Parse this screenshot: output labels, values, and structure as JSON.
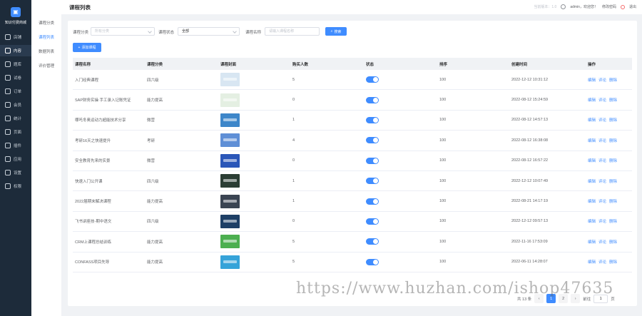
{
  "app": {
    "brand": "知识付费商城"
  },
  "rail": [
    {
      "label": "店铺",
      "icon": "shop-icon"
    },
    {
      "label": "内容",
      "icon": "content-icon"
    },
    {
      "label": "题库",
      "icon": "question-bank-icon"
    },
    {
      "label": "试卷",
      "icon": "paper-icon"
    },
    {
      "label": "订单",
      "icon": "order-icon"
    },
    {
      "label": "会员",
      "icon": "member-icon"
    },
    {
      "label": "统计",
      "icon": "stats-icon"
    },
    {
      "label": "页面",
      "icon": "page-icon"
    },
    {
      "label": "插件",
      "icon": "plugin-icon"
    },
    {
      "label": "应用",
      "icon": "app-icon"
    },
    {
      "label": "设置",
      "icon": "gear-icon"
    },
    {
      "label": "权限",
      "icon": "shield-icon"
    }
  ],
  "subnav": [
    "课程分类",
    "课程列表",
    "数据列表",
    "评价管理"
  ],
  "header": {
    "title": "课程列表",
    "version": "当前版本：1.0",
    "user": "admin，欢迎您！",
    "change_password": "修改密码",
    "logout": "退出"
  },
  "filters": {
    "category_label": "课程分类",
    "category_placeholder": "所有分类",
    "status_label": "课程状态",
    "status_value": "全部",
    "name_label": "课程名称",
    "name_placeholder": "请输入课程名称",
    "search_button": "搜索",
    "add_button": "添加课程"
  },
  "table": {
    "columns": [
      "课程名称",
      "课程分类",
      "课程封面",
      "购买人数",
      "状态",
      "排序",
      "创建时间",
      "操作"
    ],
    "actions": [
      "编辑",
      "评论",
      "删除"
    ],
    "rows": [
      {
        "name": "入门经典课程",
        "category": "四六级",
        "buyers": "5",
        "sort": "100",
        "created": "2022-12-12 10:31:12",
        "thumb": "#d8e6f2"
      },
      {
        "name": "SAP财务实操 手工录入记账凭证",
        "category": "能力提高",
        "buyers": "0",
        "sort": "100",
        "created": "2022-08-12 15:24:59",
        "thumb": "#e4efe2"
      },
      {
        "name": "哪吒冬奥运动力超能技术分享",
        "category": "微营",
        "buyers": "1",
        "sort": "100",
        "created": "2022-08-12 14:57:13",
        "thumb": "#3d86c9"
      },
      {
        "name": "考研16天之快速提升",
        "category": "考研",
        "buyers": "4",
        "sort": "100",
        "created": "2022-08-12 16:38:08",
        "thumb": "#5f8fd6"
      },
      {
        "name": "安全教育先来的实景",
        "category": "微营",
        "buyers": "0",
        "sort": "100",
        "created": "2022-08-12 16:57:22",
        "thumb": "#2a56b8"
      },
      {
        "name": "快速入门公开课",
        "category": "四六级",
        "buyers": "1",
        "sort": "100",
        "created": "2022-12-12 10:07:49",
        "thumb": "#2b3d34"
      },
      {
        "name": "2022届期末解决课程",
        "category": "能力提高",
        "buyers": "1",
        "sort": "100",
        "created": "2022-08-21 14:17:19",
        "thumb": "#3a4452"
      },
      {
        "name": "飞书讲座技-期中语文",
        "category": "四六级",
        "buyers": "0",
        "sort": "100",
        "created": "2022-12-12 09:57:13",
        "thumb": "#1e3f66"
      },
      {
        "name": "CRM上课程总结训练",
        "category": "能力提高",
        "buyers": "5",
        "sort": "100",
        "created": "2022-11-16 17:53:09",
        "thumb": "#4caf50"
      },
      {
        "name": "CONFASS项目先导",
        "category": "能力提高",
        "buyers": "5",
        "sort": "100",
        "created": "2022-06-11 14:28:07",
        "thumb": "#36a3d9"
      }
    ]
  },
  "pagination": {
    "total": "共 13 条",
    "pages": [
      "1",
      "2"
    ],
    "current": "1",
    "goto_label": "前往",
    "goto_value": "1",
    "page_suffix": "页"
  },
  "watermark": "https://www.huzhan.com/ishop47635"
}
